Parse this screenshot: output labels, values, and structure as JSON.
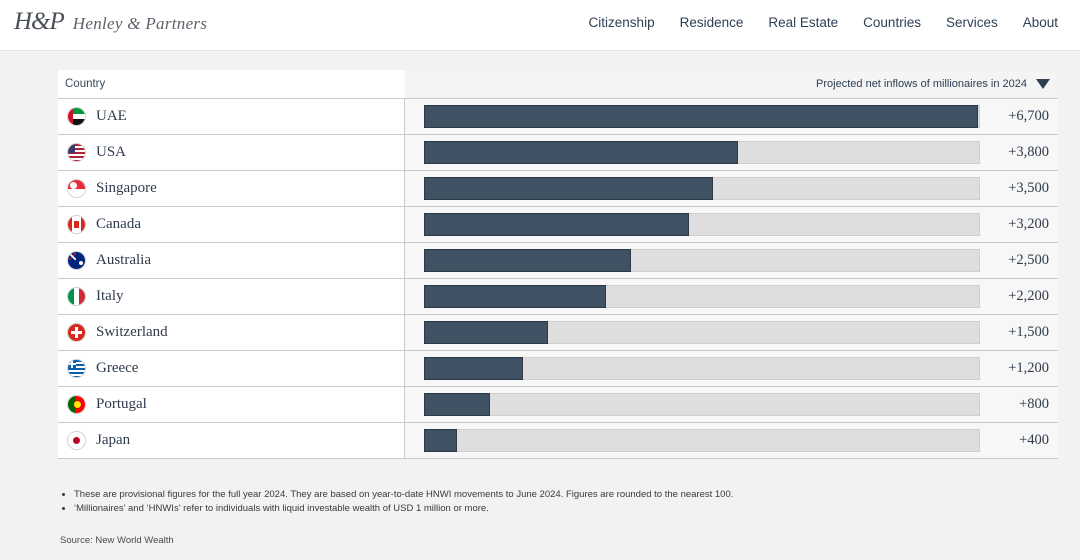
{
  "header": {
    "logo_mark": "H&P",
    "logo_name": "Henley & Partners",
    "nav": [
      {
        "label": "Citizenship"
      },
      {
        "label": "Residence"
      },
      {
        "label": "Real Estate"
      },
      {
        "label": "Countries"
      },
      {
        "label": "Services"
      },
      {
        "label": "About"
      }
    ]
  },
  "table": {
    "col_country": "Country",
    "col_metric": "Projected net inflows of millionaires in 2024",
    "sort_icon": "caret-down-icon"
  },
  "chart_data": {
    "type": "bar",
    "title": "Projected net inflows of millionaires in 2024",
    "xlabel": "",
    "ylabel": "Country",
    "orientation": "horizontal",
    "grid": false,
    "legend": "none",
    "xlim": [
      0,
      6700
    ],
    "categories": [
      "UAE",
      "USA",
      "Singapore",
      "Canada",
      "Australia",
      "Italy",
      "Switzerland",
      "Greece",
      "Portugal",
      "Japan"
    ],
    "values": [
      6700,
      3800,
      3500,
      3200,
      2500,
      2200,
      1500,
      1200,
      800,
      400
    ],
    "value_labels": [
      "+6,700",
      "+3,800",
      "+3,500",
      "+3,200",
      "+2,500",
      "+2,200",
      "+1,500",
      "+1,200",
      "+800",
      "+400"
    ],
    "bar_color": "#3f5163",
    "track_color": "#dedede"
  },
  "rows": [
    {
      "country": "UAE",
      "flag": "flag-ae",
      "value": 6700,
      "label": "+6,700"
    },
    {
      "country": "USA",
      "flag": "flag-us",
      "value": 3800,
      "label": "+3,800"
    },
    {
      "country": "Singapore",
      "flag": "flag-sg",
      "value": 3500,
      "label": "+3,500"
    },
    {
      "country": "Canada",
      "flag": "flag-ca",
      "value": 3200,
      "label": "+3,200"
    },
    {
      "country": "Australia",
      "flag": "flag-au",
      "value": 2500,
      "label": "+2,500"
    },
    {
      "country": "Italy",
      "flag": "flag-it",
      "value": 2200,
      "label": "+2,200"
    },
    {
      "country": "Switzerland",
      "flag": "flag-ch",
      "value": 1500,
      "label": "+1,500"
    },
    {
      "country": "Greece",
      "flag": "flag-gr",
      "value": 1200,
      "label": "+1,200"
    },
    {
      "country": "Portugal",
      "flag": "flag-pt",
      "value": 800,
      "label": "+800"
    },
    {
      "country": "Japan",
      "flag": "flag-jp",
      "value": 400,
      "label": "+400"
    }
  ],
  "footnotes": [
    "These are provisional figures for the full year 2024. They are based on year-to-date HNWI movements to June 2024. Figures are rounded to the nearest 100.",
    "‘Millionaires’ and ‘HNWIs’ refer to individuals with liquid investable wealth of USD 1 million or more."
  ],
  "source": "Source: New World Wealth"
}
